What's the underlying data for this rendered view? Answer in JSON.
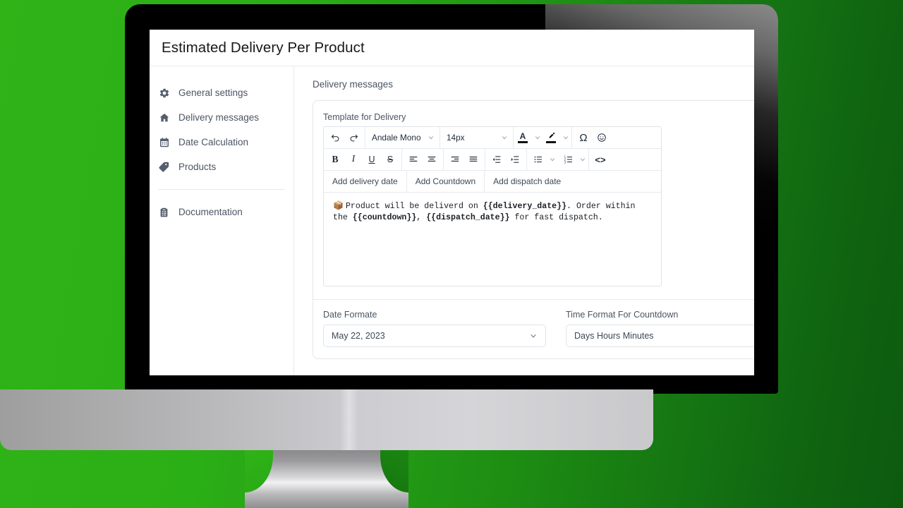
{
  "window": {
    "title": "Estimated Delivery Per Product"
  },
  "sidebar": {
    "items": [
      {
        "label": "General settings",
        "icon": "gear-icon"
      },
      {
        "label": "Delivery messages",
        "icon": "home-icon"
      },
      {
        "label": "Date Calculation",
        "icon": "calendar-icon"
      },
      {
        "label": "Products",
        "icon": "tag-icon"
      }
    ],
    "footer_items": [
      {
        "label": "Documentation",
        "icon": "clipboard-icon"
      }
    ]
  },
  "content": {
    "section_label": "Delivery messages",
    "editor": {
      "field_label": "Template for Delivery",
      "font_family": "Andale Mono",
      "font_size": "14px",
      "toolbar_row1": [
        {
          "name": "undo-icon",
          "label": "undo"
        },
        {
          "name": "redo-icon",
          "label": "redo"
        },
        {
          "name": "text-color-icon",
          "label": "A"
        },
        {
          "name": "highlight-color-icon",
          "label": "highlight"
        },
        {
          "name": "special-character-icon",
          "label": "Ω"
        },
        {
          "name": "emoji-icon",
          "label": "☺"
        }
      ],
      "toolbar_row2": [
        {
          "name": "bold-icon",
          "label": "B"
        },
        {
          "name": "italic-icon",
          "label": "I"
        },
        {
          "name": "underline-icon",
          "label": "U"
        },
        {
          "name": "strikethrough-icon",
          "label": "S"
        },
        {
          "name": "align-left-icon",
          "label": "align left"
        },
        {
          "name": "align-center-icon",
          "label": "align center"
        },
        {
          "name": "align-right-icon",
          "label": "align right"
        },
        {
          "name": "align-justify-icon",
          "label": "justify"
        },
        {
          "name": "outdent-icon",
          "label": "outdent"
        },
        {
          "name": "indent-icon",
          "label": "indent"
        },
        {
          "name": "bullet-list-icon",
          "label": "bullet list"
        },
        {
          "name": "numbered-list-icon",
          "label": "numbered list"
        },
        {
          "name": "source-code-icon",
          "label": "<>"
        }
      ],
      "shortcuts": [
        "Add delivery date",
        "Add Countdown",
        "Add dispatch date"
      ],
      "body_emoji": "📦",
      "body_segments": [
        {
          "text": "Product will be deliverd on ",
          "bold": false
        },
        {
          "text": "{{delivery_date}}",
          "bold": true
        },
        {
          "text": ". Order within the ",
          "bold": false
        },
        {
          "text": "{{countdown}}",
          "bold": true
        },
        {
          "text": ", ",
          "bold": false
        },
        {
          "text": "{{dispatch_date}}",
          "bold": true
        },
        {
          "text": " for fast dispatch.",
          "bold": false
        }
      ]
    },
    "fields": [
      {
        "label": "Date Formate",
        "value": "May 22, 2023",
        "has_chevron": true
      },
      {
        "label": "Time Format For Countdown",
        "value": "Days Hours Minutes",
        "has_chevron": false
      }
    ]
  },
  "colors": {
    "background_green_light": "#2FB317",
    "background_green_dark": "#106611",
    "bezel": "#000000",
    "chin": "#cdcdd1",
    "text_primary": "#16181d",
    "text_secondary": "#4b5563",
    "border": "#e3e6ea"
  }
}
